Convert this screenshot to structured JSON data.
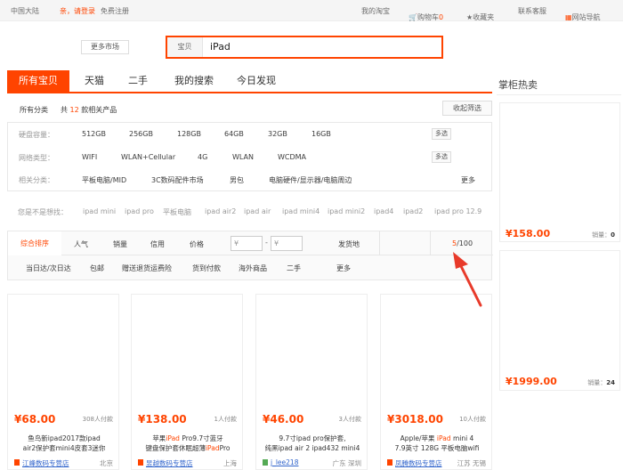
{
  "topbar": {
    "region": "中国大陆",
    "greeting": "亲，请登录",
    "register": "免费注册",
    "my_taobao": "我的淘宝",
    "cart_label": "购物车",
    "cart_count": "0",
    "favorites": "收藏夹",
    "customer_service": "联系客服",
    "site_nav": "网站导航"
  },
  "search": {
    "more_market": "更多市场",
    "type": "宝贝",
    "query": "iPad"
  },
  "tabs": [
    "所有宝贝",
    "天猫",
    "二手",
    "我的搜索",
    "今日发现"
  ],
  "summary": {
    "all_categories": "所有分类",
    "prefix": "共",
    "count": "12",
    "suffix": "款相关产品",
    "collapse": "收起筛选"
  },
  "filters": [
    {
      "label": "硬盘容量：",
      "options": [
        "512GB",
        "256GB",
        "128GB",
        "64GB",
        "32GB",
        "16GB"
      ],
      "action": "多选"
    },
    {
      "label": "网络类型：",
      "options": [
        "WIFI",
        "WLAN+Cellular",
        "4G",
        "WLAN",
        "WCDMA"
      ],
      "action": "多选"
    },
    {
      "label": "相关分类：",
      "options": [
        "平板电脑/MID",
        "3C数码配件市场",
        "男包",
        "电脑硬件/显示器/电脑周边"
      ],
      "action": "更多"
    }
  ],
  "suggest": {
    "label": "您是不是想找：",
    "items": [
      "ipad mini",
      "ipad pro",
      "平板电脑",
      "ipad air2",
      "ipad air",
      "ipad mini4",
      "ipad mini2",
      "ipad4",
      "ipad2",
      "ipad pro 12.9"
    ]
  },
  "sort": {
    "items": [
      "综合排序",
      "人气",
      "销量",
      "信用",
      "价格"
    ],
    "price_from": "¥",
    "price_to": "¥",
    "dash": "-",
    "ship_from": "发货地",
    "page_current": "5",
    "page_total": "/100"
  },
  "services": [
    "当日达/次日达",
    "包邮",
    "赠送退货运费险",
    "货到付款",
    "海外商品",
    "二手",
    "更多"
  ],
  "products": [
    {
      "price": "¥68.00",
      "sold": "308人付款",
      "t1": "鱼鸟新ipad2017款ipad",
      "t2": "air2保护套mini4皮套3迷你",
      "shop": "江峰数码专营店",
      "loc": "北京"
    },
    {
      "price": "¥138.00",
      "sold": "1人付款",
      "t1_a": "苹果",
      "t1_hl": "iPad",
      "t1_b": " Pro9.7寸蓝牙",
      "t2_a": "键盘保护套休眠超薄",
      "t2_hl": "iPad",
      "t2_b": "Pro",
      "shop": "昱越数码专营店",
      "loc": "上海"
    },
    {
      "price": "¥46.00",
      "sold": "3人付款",
      "t1": "9.7寸ipad pro保护套,",
      "t2": "纯黑ipad air 2 ipad432 mini4",
      "shop": "j_lee218",
      "loc": "广东 深圳"
    },
    {
      "price": "¥3018.00",
      "sold": "10人付款",
      "t1_a": "Apple/苹果 ",
      "t1_hl": "iPad",
      "t1_b": " mini 4",
      "t2": "7.9英寸 128G 平板电脑wifi",
      "shop": "凤腾数码专营店",
      "loc": "江苏 无锡"
    }
  ],
  "sidebar": {
    "title": "掌柜热卖",
    "items": [
      {
        "price": "¥158.00",
        "sales_label": "销量：",
        "sales": "0"
      },
      {
        "price": "¥1999.00",
        "sales_label": "销量：",
        "sales": "24"
      }
    ]
  },
  "colors": {
    "accent": "#ff4400",
    "link": "#3366cc",
    "arrow": "#e83a2a"
  },
  "icons": [
    "cart-icon",
    "star-icon",
    "grid-icon",
    "shop-icon",
    "arrow-annotation-icon"
  ]
}
